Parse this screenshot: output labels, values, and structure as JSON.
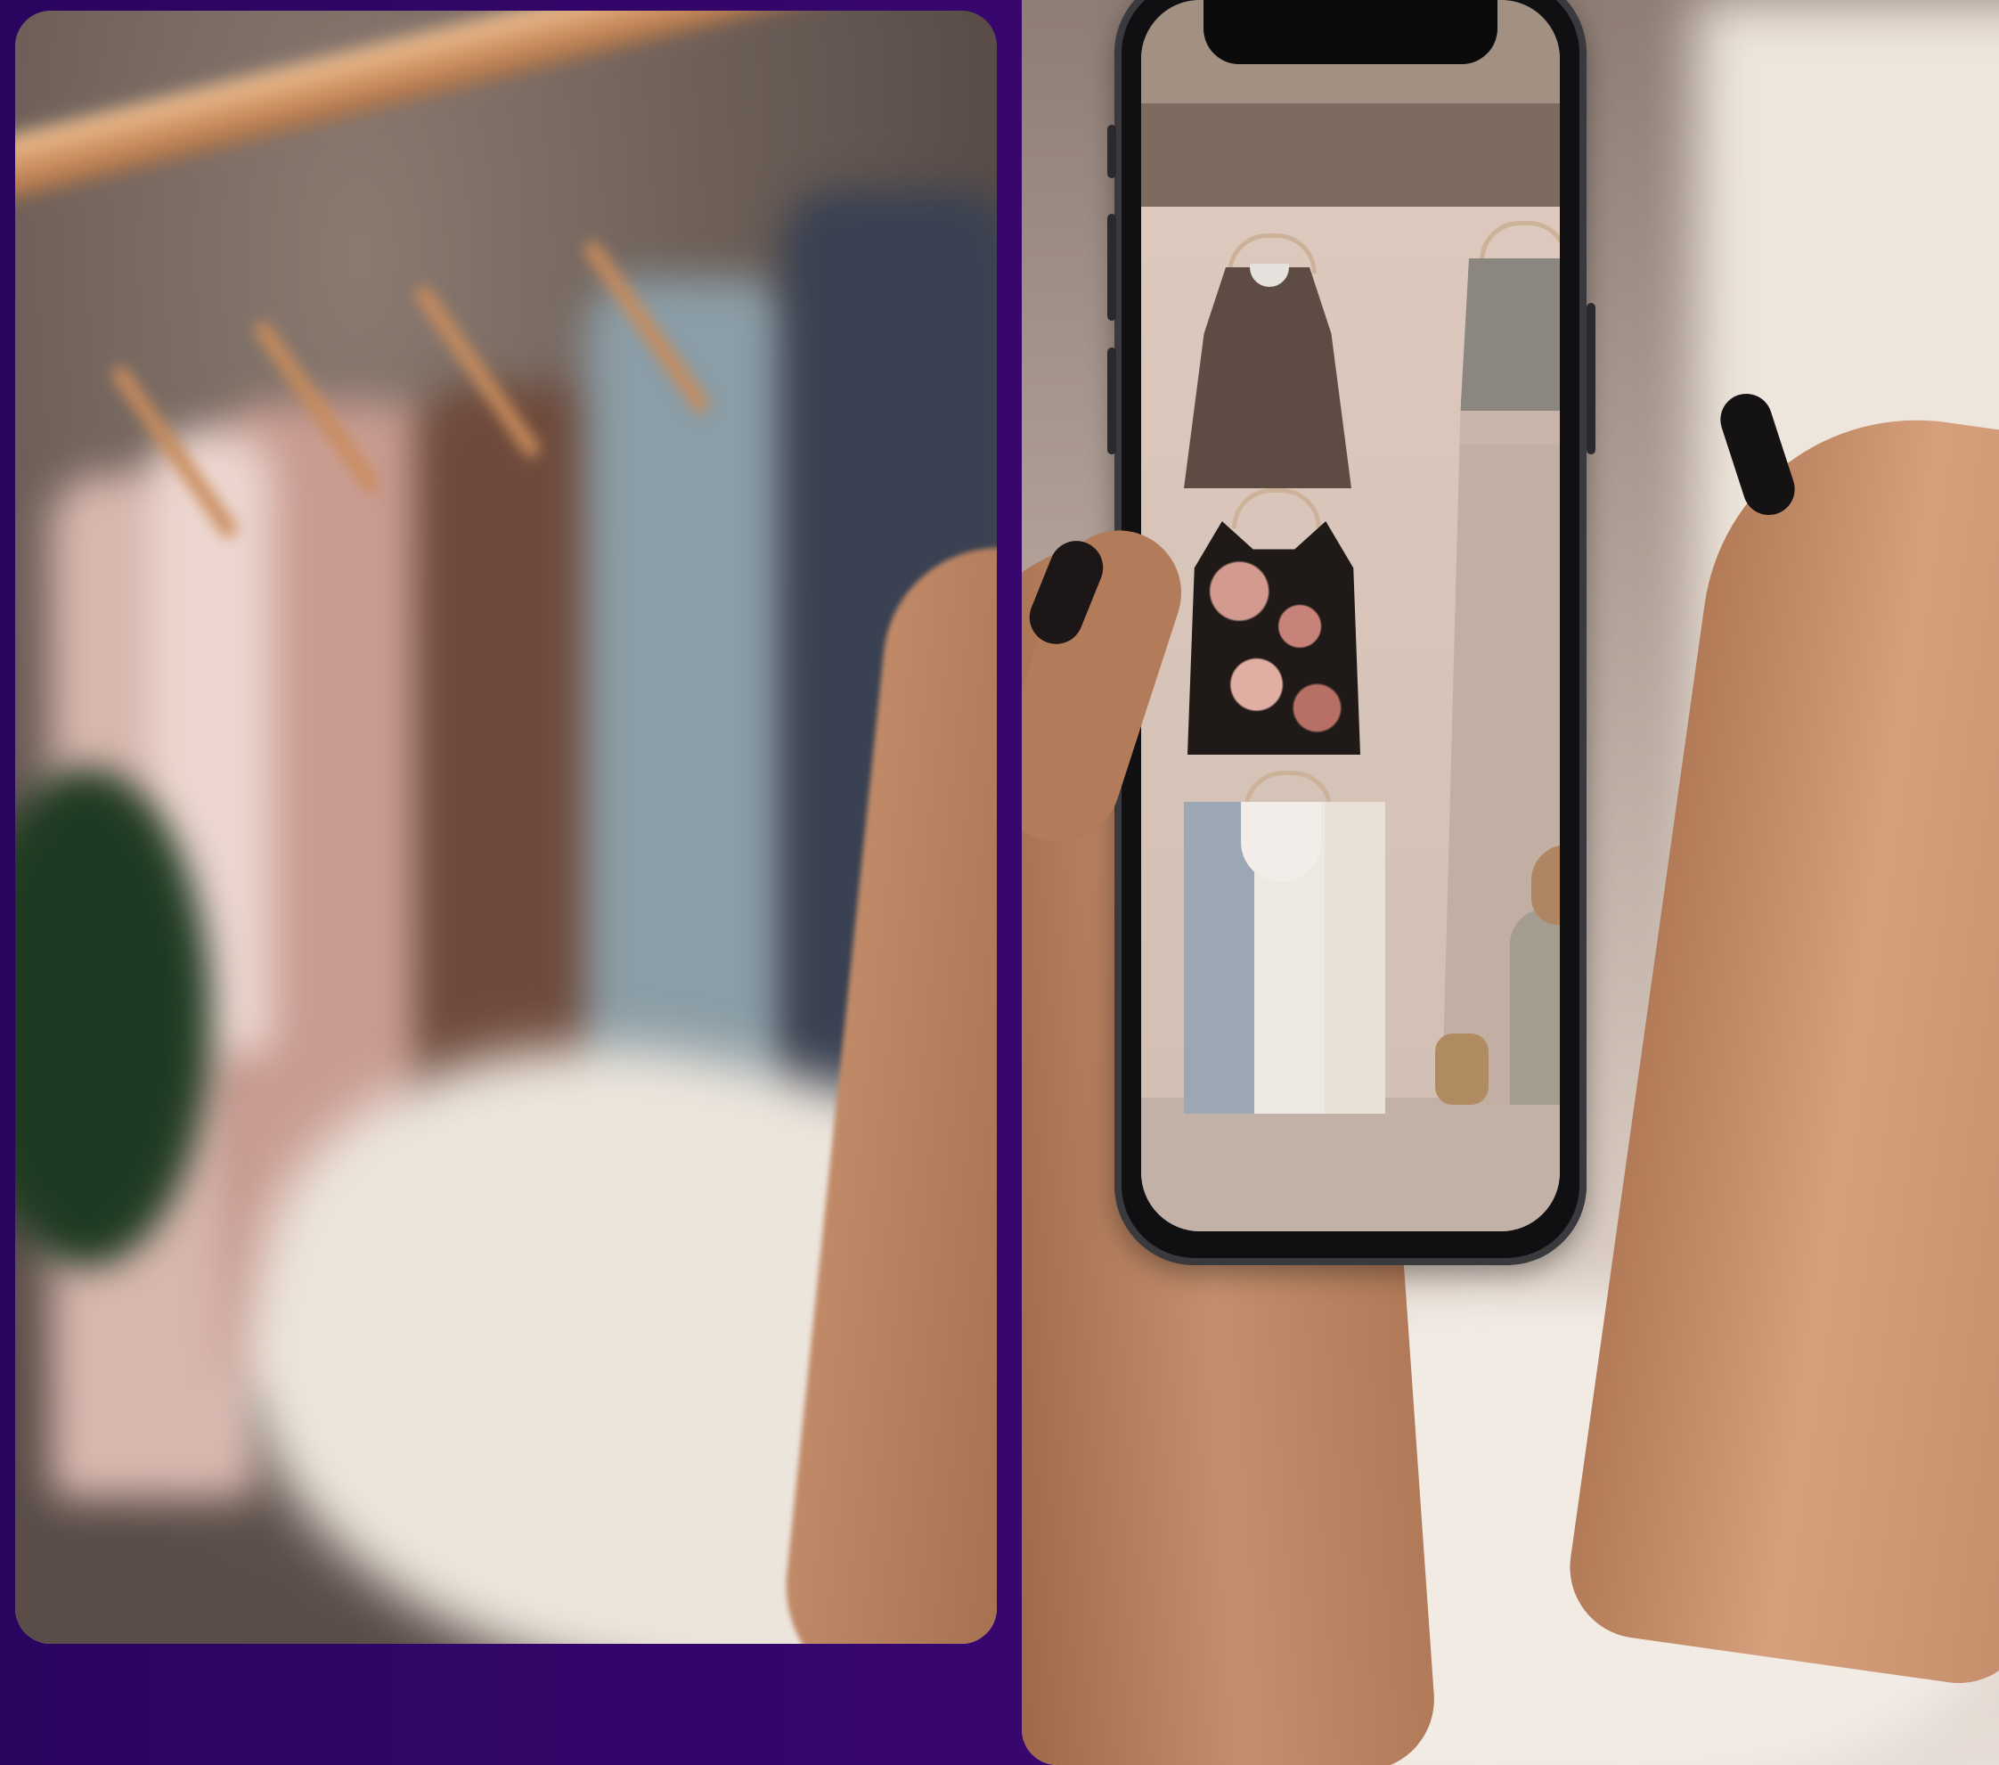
{
  "scene": {
    "left_panel": {
      "subject": "clothing-rack"
    },
    "right_panel": {
      "subject": "phone-wardrobe-view"
    }
  },
  "colors": {
    "frame_purple": "#3a0770",
    "rack_rod": "#d59a6a",
    "skin": "#c48f6d",
    "nail": "#141212",
    "phone_body": "#101012",
    "screen_wall": "#dcc8bd"
  },
  "icons": {
    "phone": "smartphone-icon"
  }
}
